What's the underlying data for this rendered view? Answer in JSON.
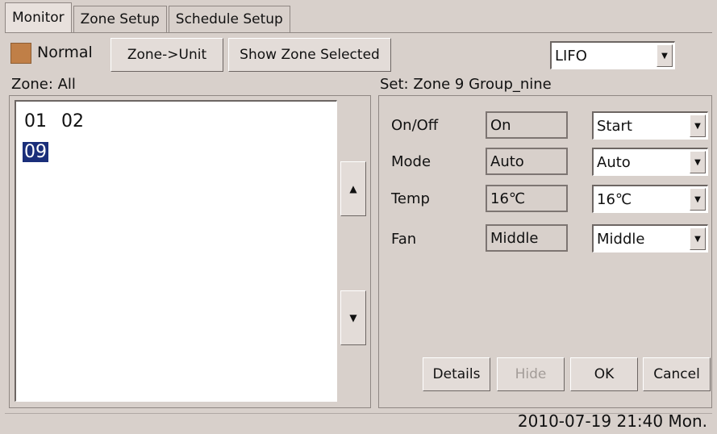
{
  "tabs": [
    {
      "label": "Monitor",
      "active": true
    },
    {
      "label": "Zone Setup",
      "active": false
    },
    {
      "label": "Schedule Setup",
      "active": false
    }
  ],
  "status": {
    "text": "Normal",
    "color": "#c07f47"
  },
  "toolbar": {
    "zone_unit_label": "Zone->Unit",
    "show_zone_label": "Show Zone Selected",
    "order_select": "LIFO"
  },
  "zone": {
    "header": "Zone: All",
    "items": [
      "01",
      "02",
      "09"
    ],
    "selected": "09"
  },
  "set": {
    "header": "Set: Zone 9 Group_nine",
    "rows": [
      {
        "label": "On/Off",
        "current": "On",
        "select": "Start"
      },
      {
        "label": "Mode",
        "current": "Auto",
        "select": "Auto"
      },
      {
        "label": "Temp",
        "current": "16℃",
        "select": "16℃"
      },
      {
        "label": "Fan",
        "current": "Middle",
        "select": "Middle"
      }
    ],
    "buttons": {
      "details": "Details",
      "hide": "Hide",
      "ok": "OK",
      "cancel": "Cancel"
    }
  },
  "datetime": "2010-07-19 21:40 Mon.",
  "colors": {
    "selection": "#1a2e7a",
    "background": "#d8d0cb"
  }
}
